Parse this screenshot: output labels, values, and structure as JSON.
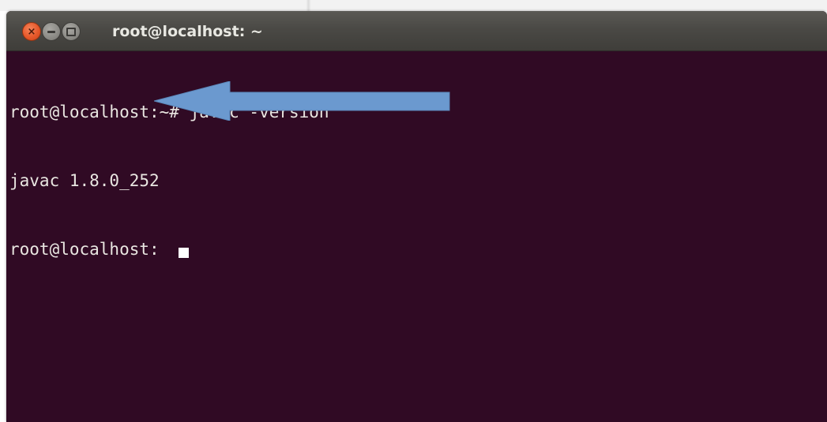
{
  "window": {
    "title": "root@localhost: ~",
    "controls": {
      "close_icon": "close-icon",
      "minimize_icon": "minimize-icon",
      "maximize_icon": "maximize-icon"
    }
  },
  "terminal": {
    "lines": [
      "root@localhost:~# javac -version",
      "javac 1.8.0_252",
      "root@localhost:"
    ],
    "colors": {
      "background": "#300a24",
      "foreground": "#e9e6e1"
    }
  },
  "annotation": {
    "icon": "left-arrow-icon",
    "color": "#6b99cf"
  }
}
